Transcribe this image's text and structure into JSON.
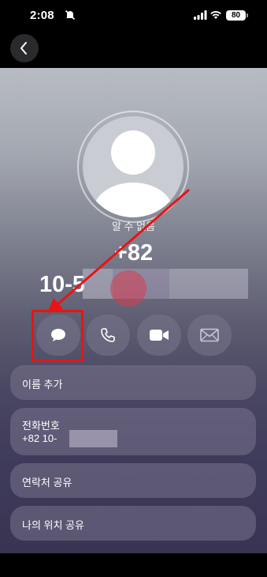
{
  "status_bar": {
    "time": "2:08",
    "battery": "80"
  },
  "contact": {
    "name": "알 수 없음",
    "number_line1": "+82",
    "number_line2": "10-5"
  },
  "actions": [
    {
      "icon": "message-icon",
      "label": "message"
    },
    {
      "icon": "phone-icon",
      "label": "call"
    },
    {
      "icon": "video-icon",
      "label": "video"
    },
    {
      "icon": "mail-icon",
      "label": "mail"
    }
  ],
  "rows": {
    "add_name": "이름 추가",
    "phone_label": "전화번호",
    "phone_value": "+82 10-",
    "share_contact": "연락처 공유",
    "share_location": "나의 위치 공유"
  },
  "colors": {
    "highlight": "#e81414",
    "arrow": "#e81414"
  }
}
